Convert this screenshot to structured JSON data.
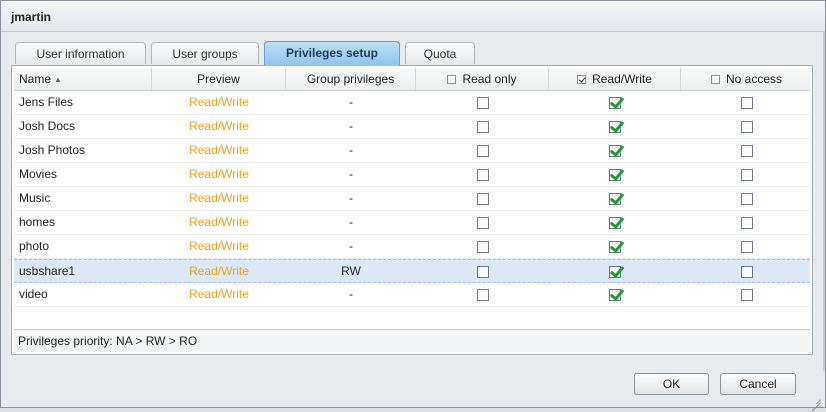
{
  "window": {
    "title": "jmartin"
  },
  "tabs": [
    {
      "label": "User information",
      "active": false
    },
    {
      "label": "User groups",
      "active": false
    },
    {
      "label": "Privileges setup",
      "active": true
    },
    {
      "label": "Quota",
      "active": false
    }
  ],
  "grid": {
    "columns": {
      "name": "Name",
      "preview": "Preview",
      "group": "Group privileges",
      "read_only": "Read only",
      "read_write": "Read/Write",
      "no_access": "No access"
    },
    "header_checks": {
      "read_only": false,
      "read_write": true,
      "no_access": false
    },
    "rows": [
      {
        "name": "Jens Files",
        "preview": "Read/Write",
        "group": "-",
        "ro": false,
        "rw": true,
        "na": false,
        "selected": false
      },
      {
        "name": "Josh Docs",
        "preview": "Read/Write",
        "group": "-",
        "ro": false,
        "rw": true,
        "na": false,
        "selected": false
      },
      {
        "name": "Josh Photos",
        "preview": "Read/Write",
        "group": "-",
        "ro": false,
        "rw": true,
        "na": false,
        "selected": false
      },
      {
        "name": "Movies",
        "preview": "Read/Write",
        "group": "-",
        "ro": false,
        "rw": true,
        "na": false,
        "selected": false
      },
      {
        "name": "Music",
        "preview": "Read/Write",
        "group": "-",
        "ro": false,
        "rw": true,
        "na": false,
        "selected": false
      },
      {
        "name": "homes",
        "preview": "Read/Write",
        "group": "-",
        "ro": false,
        "rw": true,
        "na": false,
        "selected": false
      },
      {
        "name": "photo",
        "preview": "Read/Write",
        "group": "-",
        "ro": false,
        "rw": true,
        "na": false,
        "selected": false
      },
      {
        "name": "usbshare1",
        "preview": "Read/Write",
        "group": "RW",
        "ro": false,
        "rw": true,
        "na": false,
        "selected": true
      },
      {
        "name": "video",
        "preview": "Read/Write",
        "group": "-",
        "ro": false,
        "rw": true,
        "na": false,
        "selected": false
      }
    ],
    "footer": "Privileges priority: NA > RW > RO"
  },
  "buttons": {
    "ok": "OK",
    "cancel": "Cancel"
  },
  "colors": {
    "preview_text": "#f0a020",
    "check_green": "#1f9c2a",
    "selected_row": "#dbe8f6"
  }
}
